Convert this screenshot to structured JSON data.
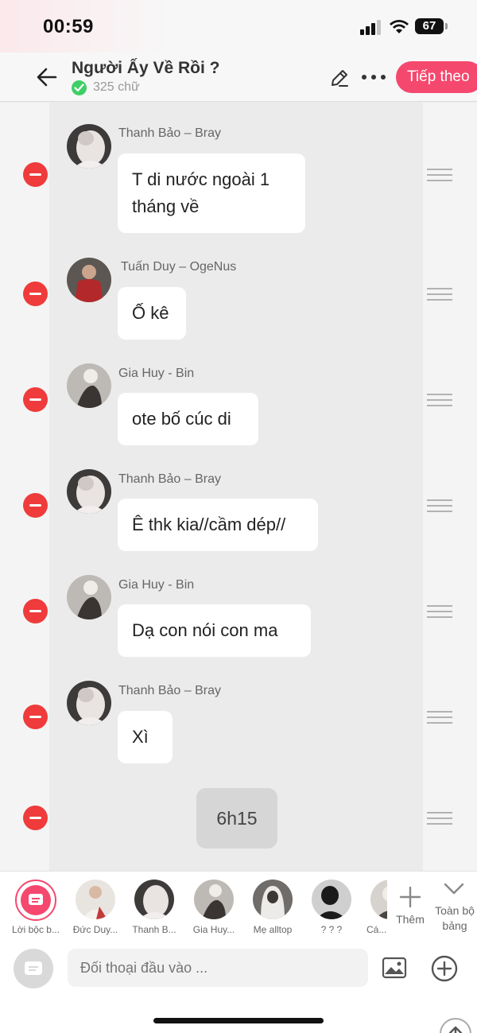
{
  "status_bar": {
    "time": "00:59",
    "battery": "67"
  },
  "header": {
    "title": "Người Ấy Về Rồi ?",
    "word_count": "325 chữ",
    "next_label": "Tiếp theo"
  },
  "messages": [
    {
      "sender": "Thanh Bảo – Bray",
      "text": "T di nước ngoài 1 tháng về"
    },
    {
      "sender": "Tuấn Duy – OgeNus",
      "text": "Ố kê"
    },
    {
      "sender": "Gia Huy - Bin",
      "text": "ote bố cúc di"
    },
    {
      "sender": "Thanh Bảo – Bray",
      "text": "Ê thk kia//cầm dép//"
    },
    {
      "sender": "Gia Huy - Bin",
      "text": "Dạ con nói con ma"
    },
    {
      "sender": "Thanh Bảo – Bray",
      "text": "Xì"
    }
  ],
  "time_chip": "6h15",
  "characters": [
    {
      "label": "Lời bộc b..."
    },
    {
      "label": "Đức Duy..."
    },
    {
      "label": "Thanh B..."
    },
    {
      "label": "Gia Huy..."
    },
    {
      "label": "Mẹ alltop"
    },
    {
      "label": "? ? ?"
    },
    {
      "label": "Cá..."
    }
  ],
  "add_character_label": "Thêm",
  "collapse_label": "Toàn bộ bảng",
  "input": {
    "placeholder": "Đối thoại đầu vào ..."
  },
  "colors": {
    "accent": "#f5486e",
    "remove": "#ef3b3b",
    "check": "#3ecf67"
  }
}
